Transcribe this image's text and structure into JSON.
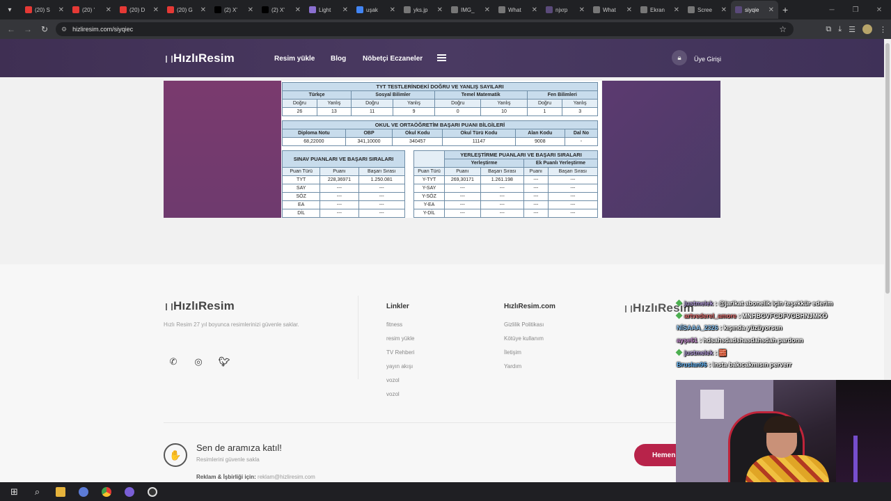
{
  "browser": {
    "tabs": [
      {
        "title": "(20) S",
        "icon": "youtube-icon",
        "color": "#e53935"
      },
      {
        "title": "(20) '",
        "icon": "youtube-icon",
        "color": "#e53935"
      },
      {
        "title": "(20) D",
        "icon": "youtube-icon",
        "color": "#e53935"
      },
      {
        "title": "(20) G",
        "icon": "youtube-icon",
        "color": "#e53935"
      },
      {
        "title": "(2) X'",
        "icon": "x-icon",
        "color": "#000000"
      },
      {
        "title": "(2) X'",
        "icon": "x-icon",
        "color": "#000000"
      },
      {
        "title": "Light",
        "icon": "feather-icon",
        "color": "#8a6fd0"
      },
      {
        "title": "uşak",
        "icon": "google-icon",
        "color": "#4285f4"
      },
      {
        "title": "yks.jp",
        "icon": "globe-icon",
        "color": "#777777"
      },
      {
        "title": "IMG_",
        "icon": "globe-icon",
        "color": "#777777"
      },
      {
        "title": "What",
        "icon": "globe-icon",
        "color": "#777777"
      },
      {
        "title": "njxrp",
        "icon": "hizliresim-icon",
        "color": "#5a4a7a"
      },
      {
        "title": "What",
        "icon": "globe-icon",
        "color": "#777777"
      },
      {
        "title": "Ekran",
        "icon": "globe-icon",
        "color": "#777777"
      },
      {
        "title": "Scree",
        "icon": "globe-icon",
        "color": "#777777"
      },
      {
        "title": "siyqie",
        "icon": "hizliresim-icon",
        "color": "#5a4a7a",
        "active": true
      }
    ],
    "url": "hizliresim.com/siyqiec"
  },
  "header": {
    "logo": "HızlıResim",
    "nav": [
      "Resim yükle",
      "Blog",
      "Nöbetçi Eczaneler"
    ],
    "login": "Üye Girişi"
  },
  "tyt": {
    "title": "TYT TESTLERİNDEKİ DOĞRU VE YANLIŞ SAYILARI",
    "subjects": [
      "Türkçe",
      "Sosyal Bilimler",
      "Temel Matematik",
      "Fen Bilimleri"
    ],
    "dogru_label": "Doğru",
    "yanlis_label": "Yanlış",
    "values": [
      "26",
      "13",
      "11",
      "9",
      "0",
      "10",
      "1",
      "3"
    ]
  },
  "okul": {
    "title": "OKUL VE ORTAÖĞRETİM BAŞARI PUANI BİLGİLERİ",
    "headers": [
      "Diploma Notu",
      "OBP",
      "Okul Kodu",
      "Okul Türü Kodu",
      "Alan Kodu",
      "Dal No"
    ],
    "values": [
      "68,22000",
      "341,10000",
      "340457",
      "11147",
      "9008",
      "-"
    ]
  },
  "sinav": {
    "title": "SINAV PUANLARI VE BAŞARI SIRALARI",
    "headers": [
      "Puan Türü",
      "Puanı",
      "Başarı Sırası"
    ],
    "rows": [
      [
        "TYT",
        "228,36971",
        "1.250.081"
      ],
      [
        "SAY",
        "---",
        "---"
      ],
      [
        "SÖZ",
        "---",
        "---"
      ],
      [
        "EA",
        "---",
        "---"
      ],
      [
        "DİL",
        "---",
        "---"
      ]
    ]
  },
  "yerlestirme": {
    "title": "YERLEŞTİRME PUANLARI VE BAŞARI SIRALARI",
    "group1": "Yerleştirme",
    "group2": "Ek Puanlı Yerleştirme",
    "headers": [
      "Puan Türü",
      "Puanı",
      "Başarı Sırası",
      "Puanı",
      "Başarı Sırası"
    ],
    "rows": [
      [
        "Y-TYT",
        "269,30171",
        "1.261.198",
        "---",
        "---"
      ],
      [
        "Y-SAY",
        "---",
        "---",
        "---",
        "---"
      ],
      [
        "Y-SÖZ",
        "---",
        "---",
        "---",
        "---"
      ],
      [
        "Y-EA",
        "---",
        "---",
        "---",
        "---"
      ],
      [
        "Y-DİL",
        "---",
        "---",
        "---",
        "---"
      ]
    ]
  },
  "footer": {
    "logo": "HızlıResim",
    "tagline": "Hızlı Resim 27 yıl boyunca resimlerinizi güvenle saklar.",
    "links_title": "Linkler",
    "links": [
      "fitness",
      "resim yükle",
      "TV Rehberi",
      "yayın akışı",
      "vozol",
      "vozol"
    ],
    "site_title": "HızlıResim.com",
    "site_links": [
      "Gizlilik Politikası",
      "Kötüye kullanım",
      "İletişim",
      "Yardım"
    ],
    "join_title": "Sen de aramıza katıl!",
    "join_sub": "Resimlerini güvenle sakla",
    "ad_label": "Reklam & İşbirliği için:",
    "ad_email": "reklam@hizliresim.com",
    "cta": "Hemen"
  },
  "chat": [
    {
      "user": "justmelek",
      "color": "#b39ddb",
      "msg": ": @jarikat abonelik için teşekkür ederim",
      "badge": true
    },
    {
      "user": "artvederel_amore",
      "color": "#e57373",
      "msg": ": MNHBGVFCDFVGBHNJMKÖ",
      "badge": true
    },
    {
      "user": "NİSAAA_2326",
      "color": "#90caf9",
      "msg": ": kışında yüzüyorsun",
      "badge": false
    },
    {
      "user": "ayşe61",
      "color": "#ce93d8",
      "msg": ": hdsahsdadshasdahsdah pardonn",
      "badge": false
    },
    {
      "user": "justmelek",
      "color": "#b39ddb",
      "msg": ": 🧱",
      "badge": true
    },
    {
      "user": "Bruslan96",
      "color": "#64b5f6",
      "msg": ": insta bakıcakmısın perverr",
      "badge": false
    }
  ]
}
